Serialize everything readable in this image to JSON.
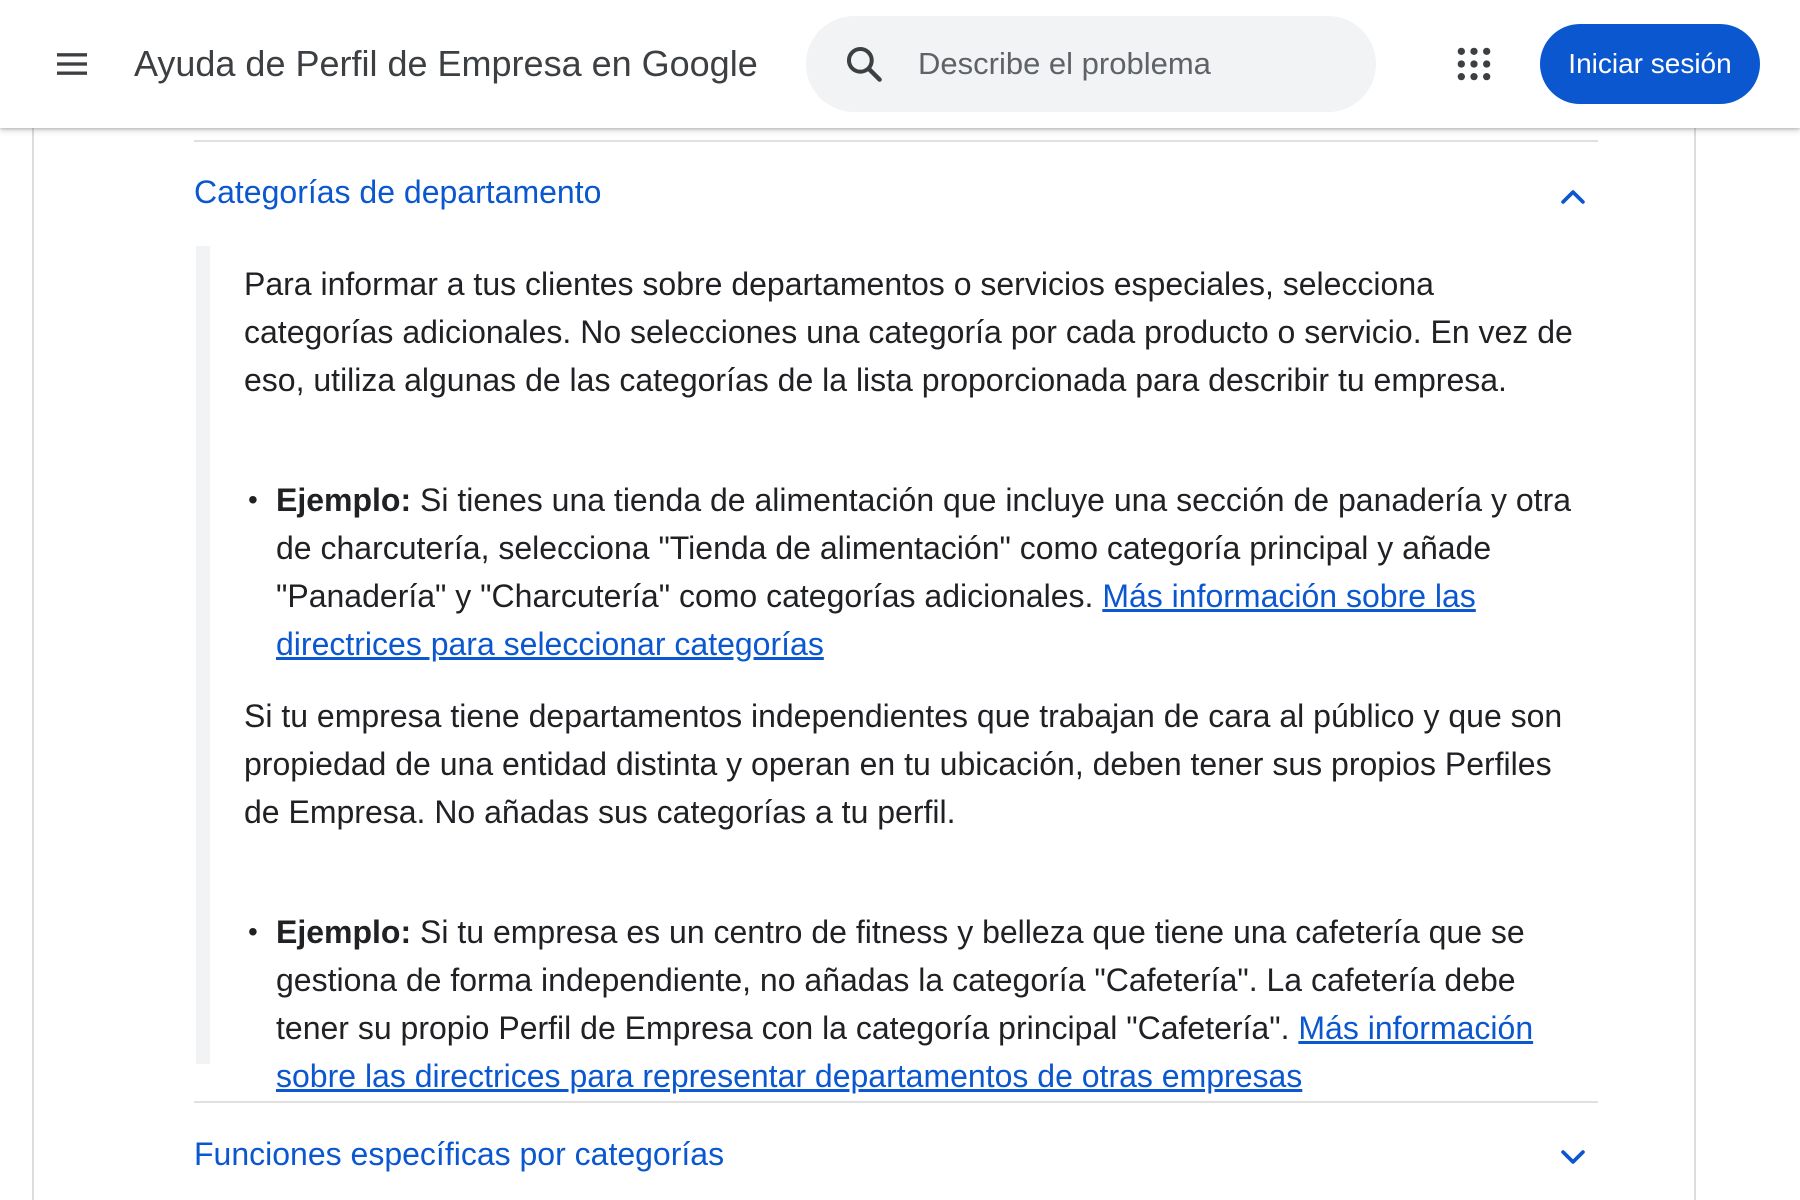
{
  "header": {
    "title": "Ayuda de Perfil de Empresa en Google",
    "search_placeholder": "Describe el problema",
    "signin_label": "Iniciar sesión",
    "icons": [
      "menu-icon",
      "search-icon",
      "apps-grid-icon"
    ]
  },
  "accordion": [
    {
      "title": "Categorías de departamento",
      "expanded": true,
      "paragraph1": "Para informar a tus clientes sobre departamentos o servicios especiales, selecciona categorías adicionales. No selecciones una categoría por cada producto o servicio. En vez de eso, utiliza algunas de las categorías de la lista proporcionada para describir tu empresa.",
      "bullet1": {
        "label": "Ejemplo:",
        "text": " Si tienes una tienda de alimentación que incluye una sección de panadería y otra de charcutería, selecciona \"Tienda de alimentación\" como categoría principal y añade \"Panadería\" y \"Charcutería\" como categorías adicionales. ",
        "link": "Más información sobre las directrices para seleccionar categorías"
      },
      "paragraph2": "Si tu empresa tiene departamentos independientes que trabajan de cara al público y que son propiedad de una entidad distinta y operan en tu ubicación, deben tener sus propios Perfiles de Empresa. No añadas sus categorías a tu perfil.",
      "bullet2": {
        "label": "Ejemplo:",
        "text": " Si tu empresa es un centro de fitness y belleza que tiene una cafetería que se gestiona de forma independiente, no añadas la categoría \"Cafetería\". La cafetería debe tener su propio Perfil de Empresa con la categoría principal \"Cafetería\". ",
        "link": "Más información sobre las directrices para representar departamentos de otras empresas"
      }
    },
    {
      "title": "Funciones específicas por categorías",
      "expanded": false
    }
  ],
  "colors": {
    "accent": "#0b57d0",
    "text": "#202124",
    "search_bg": "#f1f3f4",
    "divider": "#e0e0e0"
  }
}
